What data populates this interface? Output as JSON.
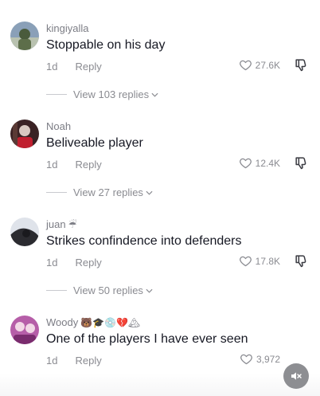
{
  "comments": [
    {
      "username": "kingiyalla",
      "badges": "",
      "text": "Stoppable on his day",
      "age": "1d",
      "reply_label": "Reply",
      "likes": "27.6K",
      "view_replies": "View 103 replies",
      "avatar_colors": [
        "#8aa0b8",
        "#b9c2b0",
        "#4a5b3c"
      ]
    },
    {
      "username": "Noah",
      "badges": "",
      "text": "Beliveable player",
      "age": "1d",
      "reply_label": "Reply",
      "likes": "12.4K",
      "view_replies": "View 27 replies",
      "avatar_colors": [
        "#3a2224",
        "#d8c8c0",
        "#c01f2f"
      ]
    },
    {
      "username": "juan",
      "badges": "☔",
      "text": "Strikes confindence into defenders",
      "age": "1d",
      "reply_label": "Reply",
      "likes": "17.8K",
      "view_replies": "View 50 replies",
      "avatar_colors": [
        "#dfe3ea",
        "#2b2b30",
        "#1a1a1e"
      ]
    },
    {
      "username": "Woody",
      "badges": "🐻🎓💿💔🏔",
      "text": "One of the players I have ever seen",
      "age": "1d",
      "reply_label": "Reply",
      "likes": "3,972",
      "view_replies": "",
      "avatar_colors": [
        "#b65ea8",
        "#f2d8e6",
        "#7a2c6e"
      ]
    }
  ],
  "icons": {
    "like": "heart-outline-icon",
    "dislike": "thumbs-down-icon",
    "expand": "chevron-down-icon",
    "mute": "speaker-muted-icon"
  },
  "colors": {
    "text": "#161823",
    "muted": "#8a8b91",
    "mute_button": "#8d8e92"
  }
}
